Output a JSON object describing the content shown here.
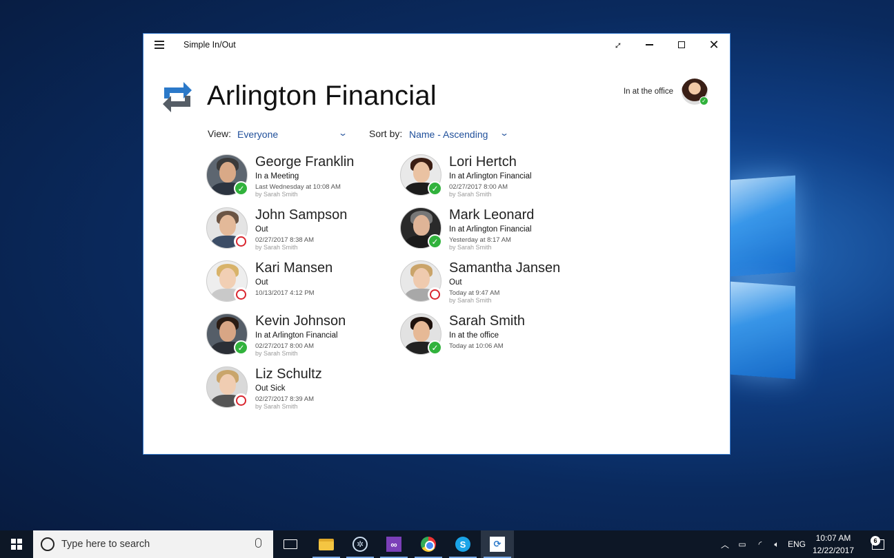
{
  "window": {
    "title": "Simple In/Out"
  },
  "header": {
    "company": "Arlington Financial",
    "current_status": "In at the office"
  },
  "filters": {
    "view_label": "View:",
    "view_value": "Everyone",
    "sort_label": "Sort by:",
    "sort_value": "Name - Ascending"
  },
  "people": [
    {
      "name": "George Franklin",
      "status": "In a Meeting",
      "time": "Last Wednesday at 10:08 AM",
      "by": "by Sarah Smith",
      "state": "in"
    },
    {
      "name": "Lori Hertch",
      "status": "In at Arlington Financial",
      "time": "02/27/2017 8:00 AM",
      "by": "by Sarah Smith",
      "state": "in"
    },
    {
      "name": "John Sampson",
      "status": "Out",
      "time": "02/27/2017 8:38 AM",
      "by": "by Sarah Smith",
      "state": "out"
    },
    {
      "name": "Mark Leonard",
      "status": "In at Arlington Financial",
      "time": "Yesterday at 8:17 AM",
      "by": "by Sarah Smith",
      "state": "in"
    },
    {
      "name": "Kari Mansen",
      "status": "Out",
      "time": "10/13/2017 4:12 PM",
      "by": "",
      "state": "out"
    },
    {
      "name": "Samantha Jansen",
      "status": "Out",
      "time": "Today at 9:47 AM",
      "by": "by Sarah Smith",
      "state": "out"
    },
    {
      "name": "Kevin Johnson",
      "status": "In at Arlington Financial",
      "time": "02/27/2017 8:00 AM",
      "by": "by Sarah Smith",
      "state": "in"
    },
    {
      "name": "Sarah Smith",
      "status": "In at the office",
      "time": "Today at 10:06 AM",
      "by": "",
      "state": "in"
    },
    {
      "name": "Liz Schultz",
      "status": "Out Sick",
      "time": "02/27/2017 8:39 AM",
      "by": "by Sarah Smith",
      "state": "out"
    }
  ],
  "taskbar": {
    "search_placeholder": "Type here to search",
    "language": "ENG",
    "time": "10:07 AM",
    "date": "12/22/2017",
    "notification_count": "6"
  },
  "colors": {
    "accent": "#1f4f9a",
    "in_badge": "#31b23c",
    "out_badge": "#d9262f"
  }
}
